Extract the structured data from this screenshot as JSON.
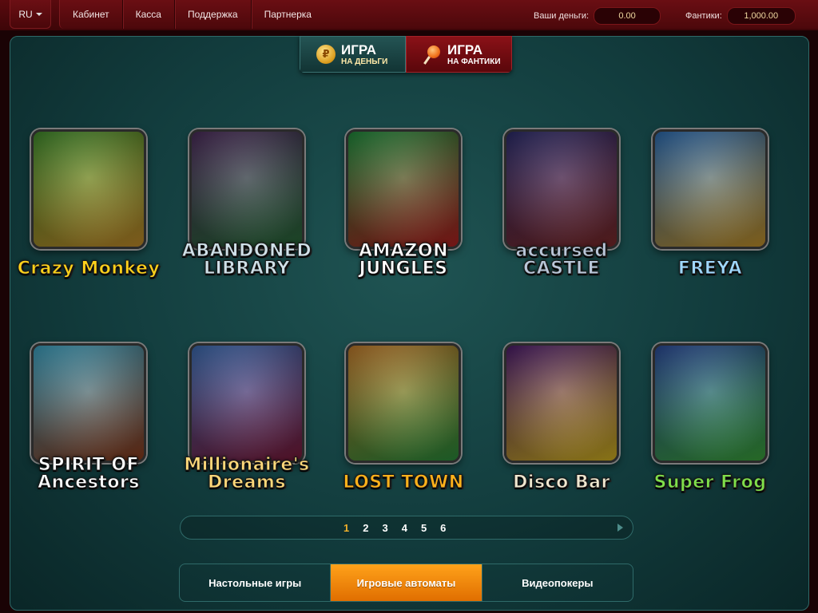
{
  "header": {
    "language": "RU",
    "nav": [
      "Кабинет",
      "Касса",
      "Поддержка",
      "Партнерка"
    ],
    "money_label": "Ваши деньги:",
    "money_value": "0.00",
    "candy_label": "Фантики:",
    "candy_value": "1,000.00"
  },
  "modes": {
    "money": {
      "title": "ИГРА",
      "subtitle": "НА ДЕНЬГИ"
    },
    "candy": {
      "title": "ИГРА",
      "subtitle": "НА ФАНТИКИ"
    }
  },
  "games": [
    {
      "name": "Crazy Monkey",
      "label": "Crazy Monkey",
      "color": "#ffd21a",
      "bg": [
        "#3f8a2a",
        "#c08a2a"
      ]
    },
    {
      "name": "Abandoned Library",
      "label": "ABANDONED LIBRARY",
      "color": "#cfe0e8",
      "bg": [
        "#4a2a5a",
        "#2a6a3a"
      ]
    },
    {
      "name": "Amazon Jungles",
      "label": "AMAZON JUNGLES",
      "color": "#ffffff",
      "bg": [
        "#1e8a3a",
        "#b02020"
      ]
    },
    {
      "name": "Accursed Castle",
      "label": "accursed CASTLE",
      "color": "#b9c6d8",
      "bg": [
        "#2a2a6a",
        "#7a2a2a"
      ]
    },
    {
      "name": "Freya",
      "label": "FREYA",
      "color": "#9fd8ff",
      "bg": [
        "#2a6ab0",
        "#c0902a"
      ]
    },
    {
      "name": "Spirit of Ancestors",
      "label": "SPIRIT OF Ancestors",
      "color": "#ffffff",
      "bg": [
        "#3aa0c0",
        "#8a3a1a"
      ]
    },
    {
      "name": "Millionaire's Dreams",
      "label": "Millionaire's Dreams",
      "color": "#ffd97a",
      "bg": [
        "#3a6ab0",
        "#7a1a3a"
      ]
    },
    {
      "name": "Lost Town",
      "label": "LOST TOWN",
      "color": "#ffb21a",
      "bg": [
        "#c07a2a",
        "#2a8a3a"
      ]
    },
    {
      "name": "Disco Bar",
      "label": "Disco Bar",
      "color": "#f0e8d0",
      "bg": [
        "#4a1a6a",
        "#d0b020"
      ]
    },
    {
      "name": "Super Frog",
      "label": "Super Frog",
      "color": "#7fe04a",
      "bg": [
        "#2a4a9a",
        "#3aa03a"
      ]
    }
  ],
  "pagination": {
    "pages": [
      "1",
      "2",
      "3",
      "4",
      "5",
      "6"
    ],
    "current": "1"
  },
  "categories": [
    {
      "label": "Настольные игры"
    },
    {
      "label": "Игровые автоматы"
    },
    {
      "label": "Видеопокеры"
    }
  ],
  "active_category_index": 1,
  "colors": {
    "accent": "#f0b02a",
    "header_bg": "#4c080b",
    "panel_bg": "#123c3d"
  }
}
